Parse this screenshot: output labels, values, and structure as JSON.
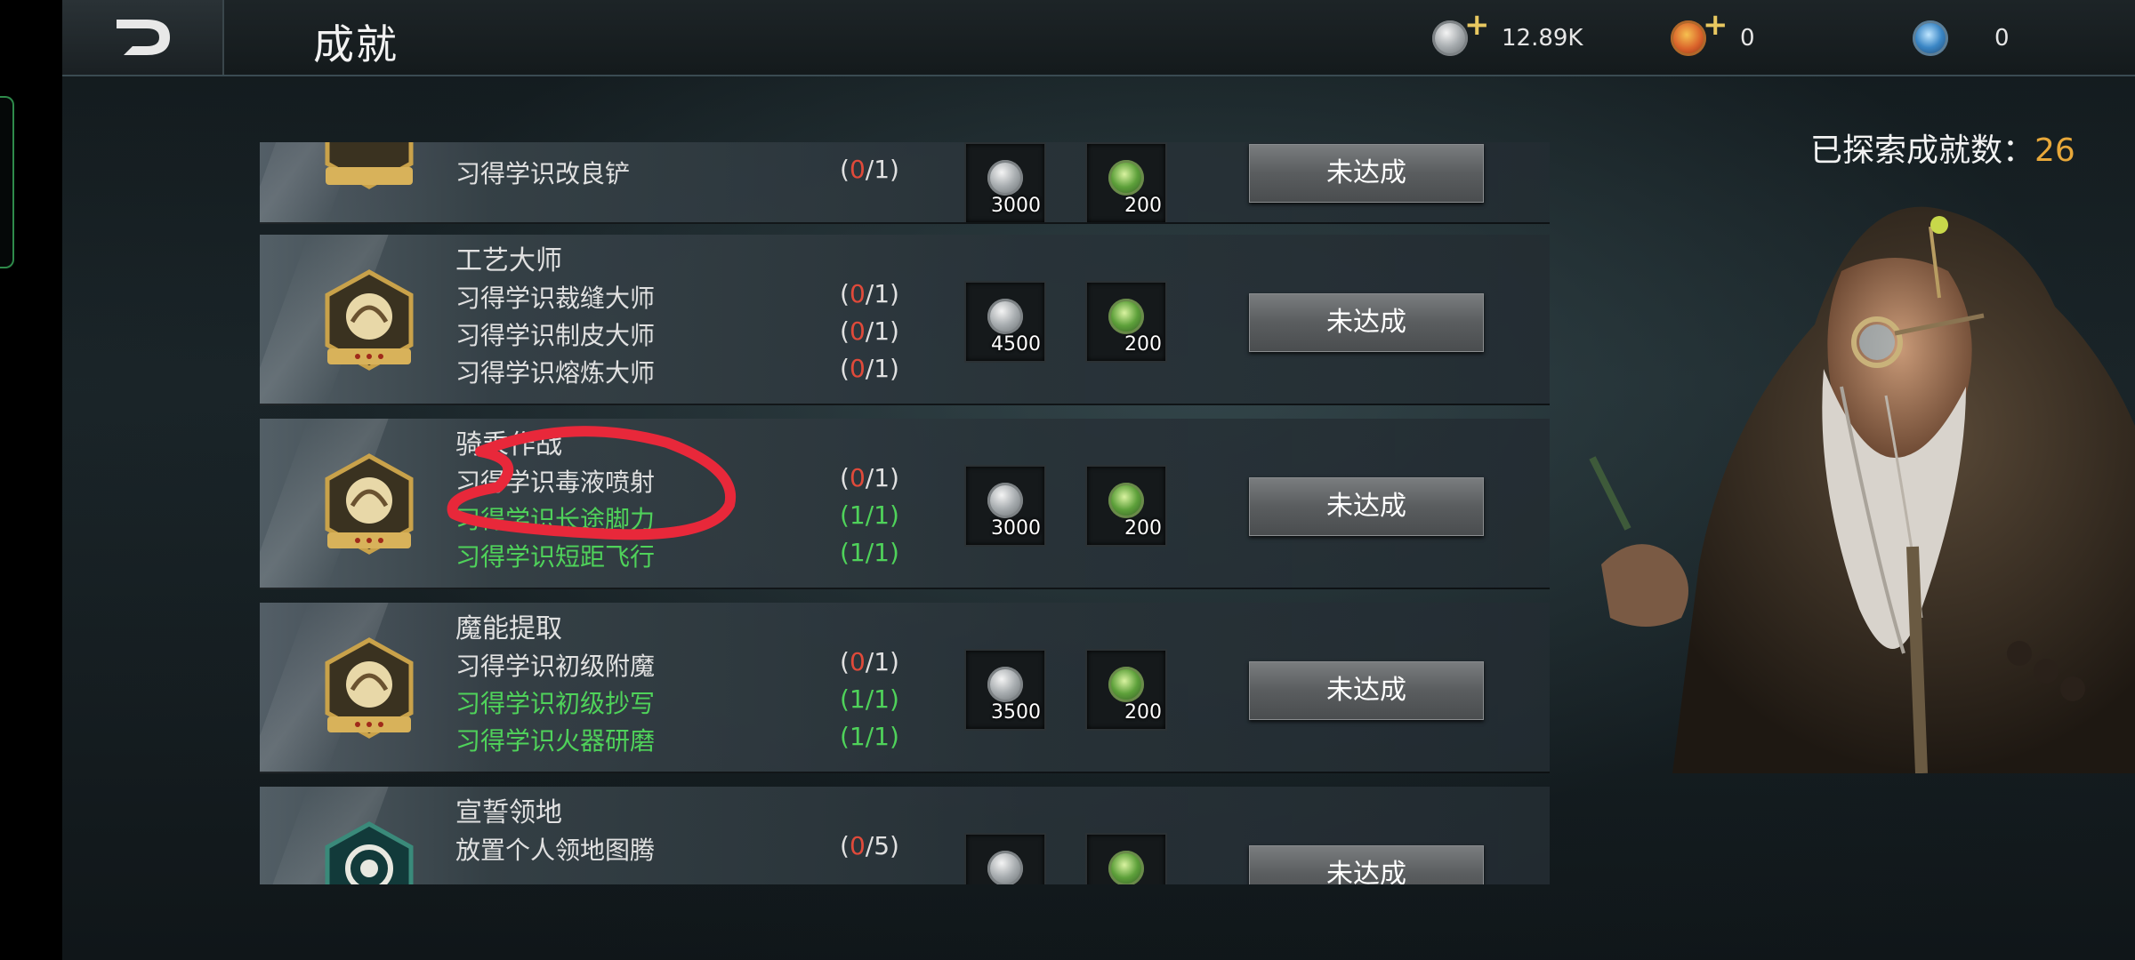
{
  "header": {
    "title": "成就",
    "currencies": [
      {
        "icon": "silver-coin-icon",
        "value": "12.89K",
        "has_plus": true
      },
      {
        "icon": "orange-coin-icon",
        "value": "0",
        "has_plus": true
      },
      {
        "icon": "blue-gem-icon",
        "value": "0",
        "has_plus": false
      }
    ]
  },
  "explored": {
    "label": "已探索成就数：",
    "count": "26"
  },
  "achievements": [
    {
      "title": "",
      "requirements": [
        {
          "text": "习得学识改良铲",
          "progress_done": "0",
          "progress_total": "/1",
          "done": false
        }
      ],
      "rewards": [
        "3000",
        "200"
      ],
      "status": "未达成"
    },
    {
      "title": "工艺大师",
      "requirements": [
        {
          "text": "习得学识裁缝大师",
          "progress_done": "0",
          "progress_total": "/1",
          "done": false
        },
        {
          "text": "习得学识制皮大师",
          "progress_done": "0",
          "progress_total": "/1",
          "done": false
        },
        {
          "text": "习得学识熔炼大师",
          "progress_done": "0",
          "progress_total": "/1",
          "done": false
        }
      ],
      "rewards": [
        "4500",
        "200"
      ],
      "status": "未达成"
    },
    {
      "title": "骑乘作战",
      "requirements": [
        {
          "text": "习得学识毒液喷射",
          "progress_done": "0",
          "progress_total": "/1",
          "done": false
        },
        {
          "text": "习得学识长途脚力",
          "progress": "(1/1)",
          "done": true
        },
        {
          "text": "习得学识短距飞行",
          "progress": "(1/1)",
          "done": true
        }
      ],
      "rewards": [
        "3000",
        "200"
      ],
      "status": "未达成"
    },
    {
      "title": "魔能提取",
      "requirements": [
        {
          "text": "习得学识初级附魔",
          "progress_done": "0",
          "progress_total": "/1",
          "done": false
        },
        {
          "text": "习得学识初级抄写",
          "progress": "(1/1)",
          "done": true
        },
        {
          "text": "习得学识火器研磨",
          "progress": "(1/1)",
          "done": true
        }
      ],
      "rewards": [
        "3500",
        "200"
      ],
      "status": "未达成"
    },
    {
      "title": "宣誓领地",
      "requirements": [
        {
          "text": "放置个人领地图腾",
          "progress_done": "0",
          "progress_total": "/5",
          "done": false
        }
      ],
      "rewards": [
        "",
        ""
      ],
      "status": "未达成"
    }
  ],
  "colors": {
    "done_green": "#4fd25a",
    "progress_red": "#e04a3a",
    "count_orange": "#e8a83a"
  }
}
